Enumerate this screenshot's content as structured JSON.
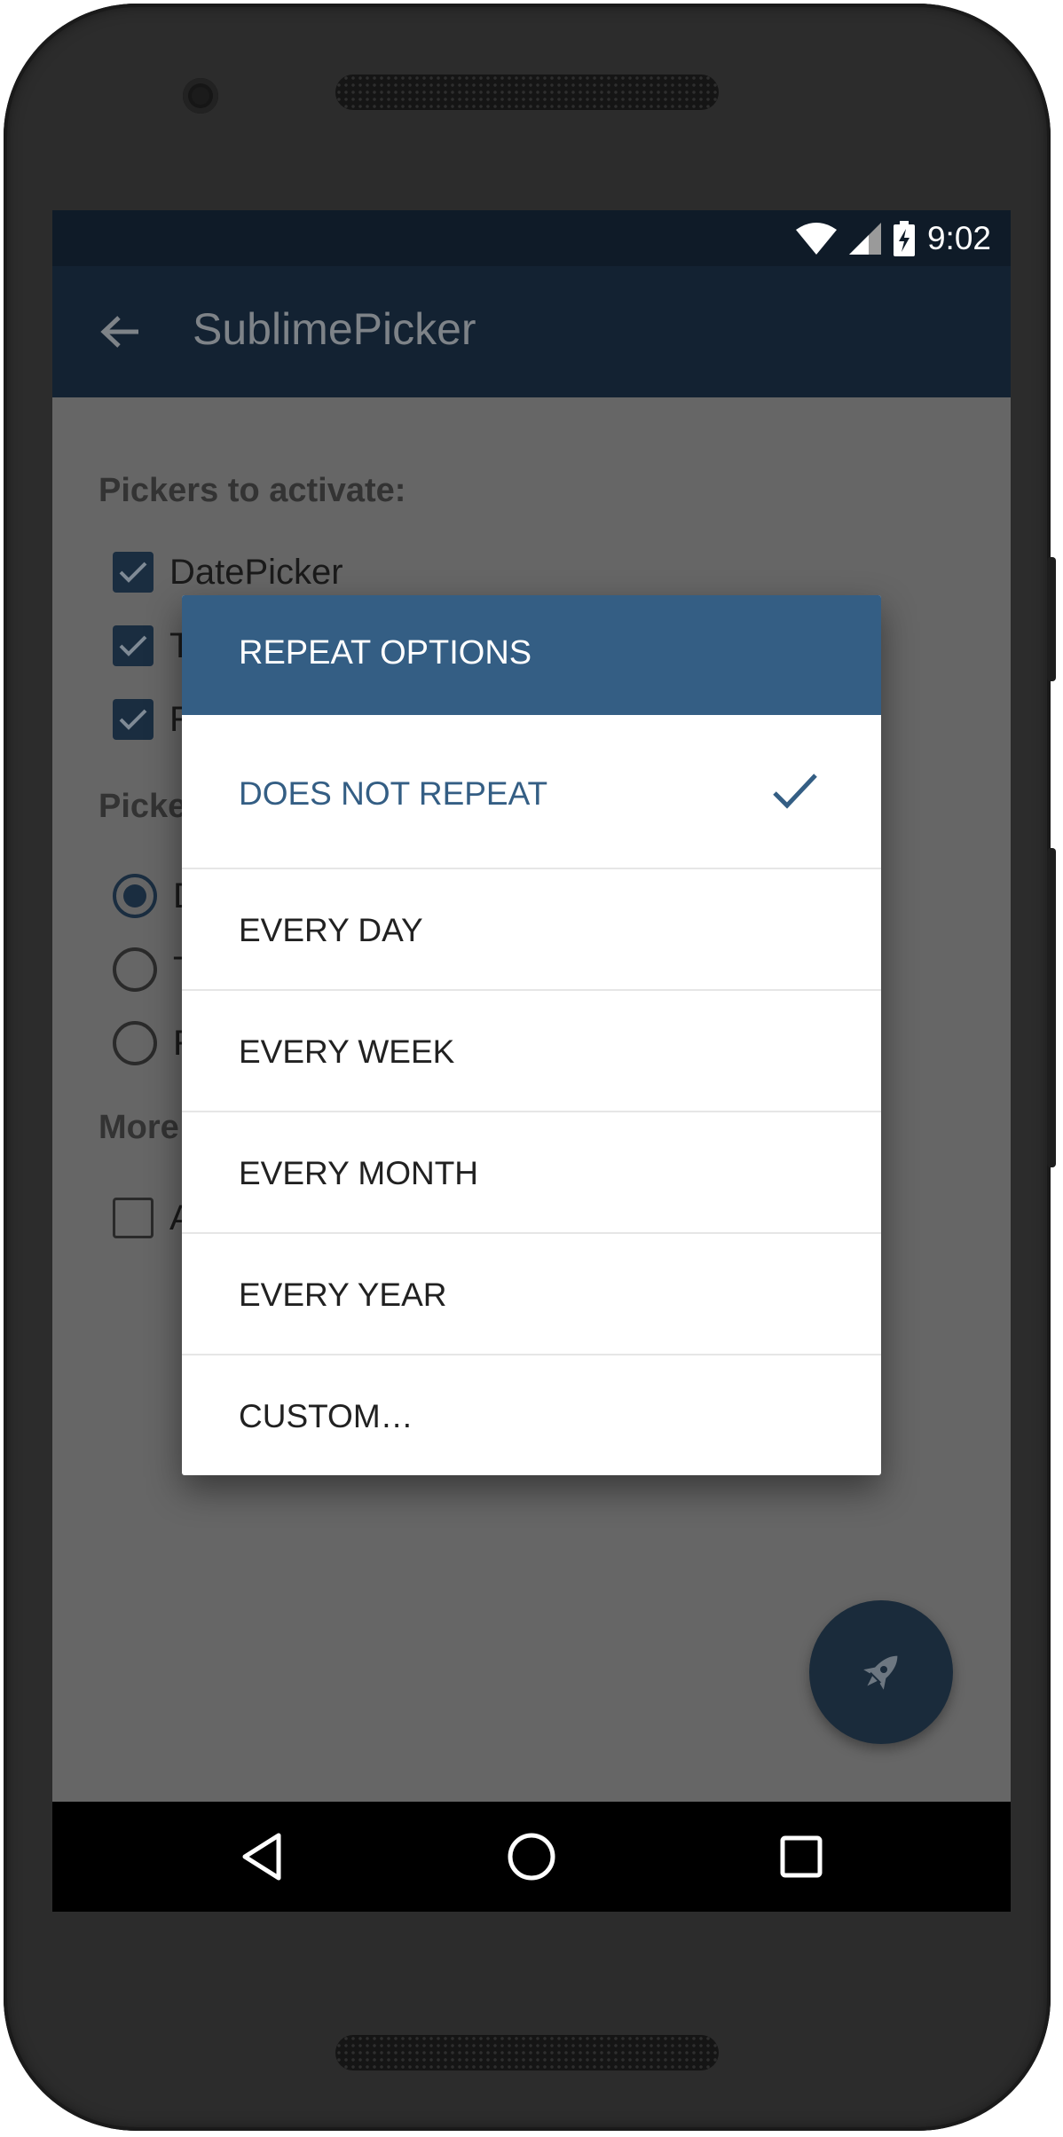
{
  "status_bar": {
    "time": "9:02",
    "icons": [
      "wifi-icon",
      "signal-icon",
      "battery-charging-icon"
    ]
  },
  "app_bar": {
    "title": "SublimePicker",
    "back_icon": "arrow-left-icon"
  },
  "content": {
    "pickers_section": {
      "title": "Pickers to activate:",
      "items": [
        {
          "label": "DatePicker",
          "checked": true
        },
        {
          "label": "T",
          "checked": true
        },
        {
          "label": "R",
          "checked": true
        }
      ]
    },
    "picker_to_show_section": {
      "title": "Picke",
      "items": [
        {
          "label": "D",
          "selected": true
        },
        {
          "label": "T",
          "selected": false
        },
        {
          "label": "R",
          "selected": false
        }
      ]
    },
    "more_section": {
      "title": "More",
      "items": [
        {
          "label": "A",
          "checked": false
        }
      ]
    }
  },
  "dialog": {
    "title": "REPEAT OPTIONS",
    "options": [
      {
        "label": "DOES NOT REPEAT",
        "selected": true
      },
      {
        "label": "EVERY DAY",
        "selected": false
      },
      {
        "label": "EVERY WEEK",
        "selected": false
      },
      {
        "label": "EVERY MONTH",
        "selected": false
      },
      {
        "label": "EVERY YEAR",
        "selected": false
      },
      {
        "label": "CUSTOM…",
        "selected": false
      }
    ]
  },
  "fab": {
    "icon": "rocket-icon"
  },
  "nav_bar": {
    "icons": [
      "back-triangle-icon",
      "home-circle-icon",
      "recents-square-icon"
    ]
  },
  "colors": {
    "status_bar": "#0f1b28",
    "app_bar": "#132232",
    "dialog_header": "#345e84",
    "selected_text": "#345e84",
    "scrim": "#666666",
    "fab": "#1a2b3b"
  }
}
